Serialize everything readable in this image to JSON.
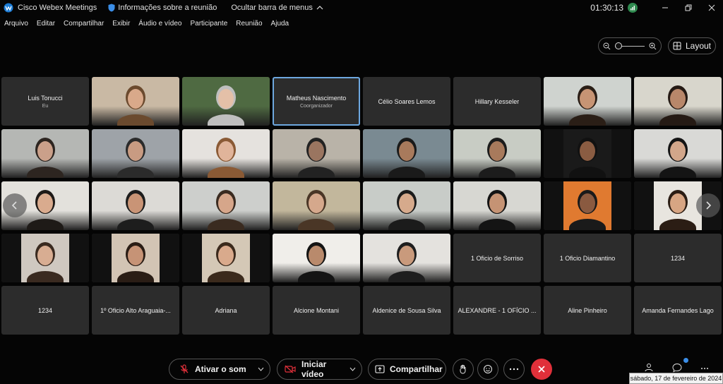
{
  "titlebar": {
    "app_name": "Cisco Webex Meetings",
    "meeting_info": "Informações sobre a reunião",
    "hide_menu": "Ocultar barra de menus",
    "time": "01:30:13"
  },
  "menu": [
    "Arquivo",
    "Editar",
    "Compartilhar",
    "Exibir",
    "Áudio e vídeo",
    "Participante",
    "Reunião",
    "Ajuda"
  ],
  "toolbar": {
    "layout_label": "Layout"
  },
  "tiles": [
    {
      "name": "Luis Tonucci",
      "sub": "Eu",
      "video": false
    },
    {
      "name": "",
      "sub": "",
      "video": true,
      "bg": "#c9b9a4",
      "skin": "#d9a98a",
      "hair": "#6b4a2e"
    },
    {
      "name": "",
      "sub": "",
      "video": true,
      "bg": "#4f6a42",
      "skin": "#e4c0a8",
      "hair": "#bfbfbf"
    },
    {
      "name": "Matheus Nascimento",
      "sub": "Coorganizador",
      "video": false,
      "selected": true
    },
    {
      "name": "Célio Soares Lemos",
      "sub": "",
      "video": false
    },
    {
      "name": "Hillary Kesseler",
      "sub": "",
      "video": false
    },
    {
      "name": "",
      "sub": "",
      "video": true,
      "bg": "#cfd3cf",
      "skin": "#c79474",
      "hair": "#2a1e16"
    },
    {
      "name": "",
      "sub": "",
      "video": true,
      "bg": "#d8d6cc",
      "skin": "#b8876a",
      "hair": "#251a14"
    },
    {
      "name": "",
      "sub": "",
      "video": true,
      "bg": "#b5b7b4",
      "skin": "#caa08a",
      "hair": "#2d2520"
    },
    {
      "name": "",
      "sub": "",
      "video": true,
      "bg": "#9ea3a8",
      "skin": "#c89b82",
      "hair": "#2b2b2b"
    },
    {
      "name": "",
      "sub": "",
      "video": true,
      "bg": "#e5e2de",
      "skin": "#e0b49a",
      "hair": "#8a5a35"
    },
    {
      "name": "",
      "sub": "",
      "video": true,
      "bg": "#b9b3a8",
      "skin": "#9a7560",
      "hair": "#222"
    },
    {
      "name": "",
      "sub": "",
      "video": true,
      "bg": "#7a8a92",
      "skin": "#a87a5c",
      "hair": "#1a1a1a"
    },
    {
      "name": "",
      "sub": "",
      "video": true,
      "bg": "#c8ccc4",
      "skin": "#a87a5c",
      "hair": "#1c1c1c"
    },
    {
      "name": "",
      "sub": "",
      "video": true,
      "bg": "#1a1a1a",
      "skin": "#8a5c42",
      "hair": "#111"
    },
    {
      "name": "",
      "sub": "",
      "video": true,
      "bg": "#d9d9d6",
      "skin": "#d2a68a",
      "hair": "#141414"
    },
    {
      "name": "",
      "sub": "",
      "video": true,
      "bg": "#e3e1dc",
      "skin": "#d9ab8e",
      "hair": "#1e1a17"
    },
    {
      "name": "",
      "sub": "",
      "video": true,
      "bg": "#dcdad6",
      "skin": "#c99476",
      "hair": "#1d1d1d"
    },
    {
      "name": "",
      "sub": "",
      "video": true,
      "bg": "#cdcfcc",
      "skin": "#d6a68a",
      "hair": "#3a2b20"
    },
    {
      "name": "",
      "sub": "",
      "video": true,
      "bg": "#c2b79c",
      "skin": "#d5a88c",
      "hair": "#4a3626"
    },
    {
      "name": "",
      "sub": "",
      "video": true,
      "bg": "#c8ccc8",
      "skin": "#d6aa8c",
      "hair": "#1b1b1b"
    },
    {
      "name": "",
      "sub": "",
      "video": true,
      "bg": "#d7d7d2",
      "skin": "#c59374",
      "hair": "#141414"
    },
    {
      "name": "",
      "sub": "",
      "video": true,
      "bg": "#e07a30",
      "skin": "#8a5a40",
      "hair": "#1a1a1a"
    },
    {
      "name": "",
      "sub": "",
      "video": true,
      "bg": "#e8e5df",
      "skin": "#d7a583",
      "hair": "#2b1d14"
    },
    {
      "name": "",
      "sub": "",
      "video": true,
      "bg": "#cfc8c0",
      "skin": "#d8ad92",
      "hair": "#3a2a20"
    },
    {
      "name": "",
      "sub": "",
      "video": true,
      "bg": "#d2c4b4",
      "skin": "#c69376",
      "hair": "#2a1d15"
    },
    {
      "name": "",
      "sub": "",
      "video": true,
      "bg": "#d4c8b6",
      "skin": "#d9aa8c",
      "hair": "#3b2a1c"
    },
    {
      "name": "",
      "sub": "",
      "video": true,
      "bg": "#f0eeea",
      "skin": "#b98a6c",
      "hair": "#141414"
    },
    {
      "name": "",
      "sub": "",
      "video": true,
      "bg": "#e4e2de",
      "skin": "#c99a7c",
      "hair": "#1e1e1e"
    },
    {
      "name": "1 Oficio de Sorriso",
      "sub": "",
      "video": false
    },
    {
      "name": "1 Oficio Diamantino",
      "sub": "",
      "video": false
    },
    {
      "name": "1234",
      "sub": "",
      "video": false
    },
    {
      "name": "1234",
      "sub": "",
      "video": false
    },
    {
      "name": "1º Oficio Alto Araguaia-...",
      "sub": "",
      "video": false
    },
    {
      "name": "Adriana",
      "sub": "",
      "video": false
    },
    {
      "name": "Alcione Montani",
      "sub": "",
      "video": false
    },
    {
      "name": "Aldenice de Sousa Silva",
      "sub": "",
      "video": false
    },
    {
      "name": "ALEXANDRE - 1 OFÍCIO ...",
      "sub": "",
      "video": false
    },
    {
      "name": "Aline Pinheiro",
      "sub": "",
      "video": false
    },
    {
      "name": "Amanda Fernandes Lago",
      "sub": "",
      "video": false
    }
  ],
  "controls": {
    "mute_label": "Ativar o som",
    "video_label": "Iniciar vídeo",
    "share_label": "Compartilhar"
  },
  "date_tooltip": "sábado, 17 de fevereiro de 2024",
  "colors": {
    "end_call": "#e0303a",
    "accent": "#6ea8e0",
    "tile_bg": "#2c2c2c"
  }
}
